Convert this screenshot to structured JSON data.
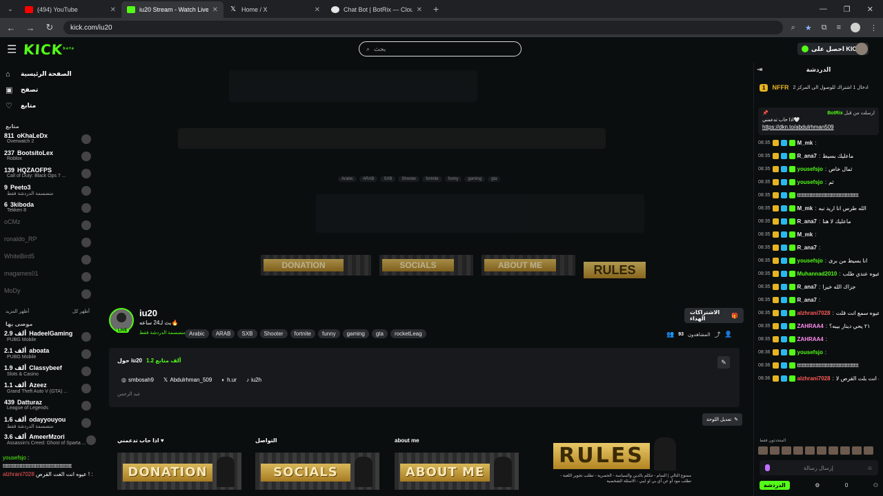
{
  "browser": {
    "tabs": [
      {
        "title": "(494) YouTube",
        "icon": "youtube-icon",
        "active": false
      },
      {
        "title": "iu20 Stream - Watch Live on Ki",
        "icon": "kick-icon",
        "active": true
      },
      {
        "title": "Home / X",
        "icon": "x-icon",
        "active": false
      },
      {
        "title": "Chat Bot | BotRix — Cloud Strea",
        "icon": "botrix-icon",
        "active": false
      }
    ],
    "url": "kick.com/iu20"
  },
  "header": {
    "logo": "KICK",
    "logo_sup": "beta",
    "search_placeholder": "بحث",
    "get_kicks": "احصل على KICKs"
  },
  "sidebar": {
    "nav": [
      {
        "label": "الصفحة الرئيسية",
        "icon": "home-icon"
      },
      {
        "label": "تصفح",
        "icon": "browse-icon"
      },
      {
        "label": "متابع",
        "icon": "heart-icon"
      }
    ],
    "following_title": "متابع",
    "following": [
      {
        "name": "oKhaLeDx",
        "viewers": "811",
        "category": "Overwatch 2"
      },
      {
        "name": "BootsitoLex",
        "viewers": "237",
        "category": "Roblox"
      },
      {
        "name": "HQZAOFPS",
        "viewers": "139",
        "category": "Call of Duty: Black Ops 7 ..."
      },
      {
        "name": "Peeto3",
        "viewers": "9",
        "category": "منصسمة الدردشة فقط"
      },
      {
        "name": "3kiboda",
        "viewers": "6",
        "category": "Tekken 8"
      }
    ],
    "offline": [
      "oCMz",
      "ronaldo_RP",
      "WhiteBird5",
      "magames01",
      "MoDy"
    ],
    "show_more": "أظهر المزيد",
    "show_all": "أظهر كل",
    "recommended_title": "موصى بها",
    "recommended": [
      {
        "name": "HadeelGaming",
        "viewers": "2.9 ألف",
        "category": "PUBG Mobile"
      },
      {
        "name": "aboata",
        "viewers": "2.1 ألف",
        "category": "PUBG Mobile"
      },
      {
        "name": "Classybeef",
        "viewers": "1.9 ألف",
        "category": "Slots & Casino"
      },
      {
        "name": "Azeez",
        "viewers": "1.1 ألف",
        "category": "Grand Theft Auto V (GTA) ..."
      },
      {
        "name": "Datturaz",
        "viewers": "439",
        "category": "League of Legends"
      },
      {
        "name": "odayyouyou",
        "viewers": "1.6 ألف",
        "category": "منصسمة الدردشة فقط"
      },
      {
        "name": "AmeerMzori",
        "viewers": "3.6 ألف",
        "category": "Assassin's Creed: Ghost of Sparta ..."
      }
    ],
    "overlay": [
      {
        "user": "yousefsjo",
        "text": ":"
      },
      {
        "user": "",
        "text": "ttttttttttttttttttttttttttttttttttttttttttttt"
      },
      {
        "user": "alzhrani7028",
        "text": "عيوه انت الغت القرص ! :"
      }
    ]
  },
  "channel": {
    "name": "iu20",
    "live_badge": "LIVE",
    "subtitle": "بث لـ24 ساعه🔥",
    "category": "منصسمة الدردشة فقط",
    "tags": [
      "Arabic",
      "ARAB",
      "SXB",
      "Shooter",
      "fortnite",
      "funny",
      "gaming",
      "gta",
      "rocketLeag"
    ],
    "sub_button": "الاشتراكات الهداء",
    "viewers_label": "المشاهدون",
    "viewers": "93",
    "about_title": "حول iu20",
    "followers": "1.2 ألف متابع",
    "socials": [
      {
        "icon": "instagram-icon",
        "label": "smbosah9"
      },
      {
        "icon": "x-icon",
        "label": "Abdulrhman_509"
      },
      {
        "icon": "discord-icon",
        "label": "h.ur"
      },
      {
        "icon": "tiktok-icon",
        "label": "iu2h"
      }
    ],
    "bio": "عبد الرحمن",
    "edit_panels": "تعديل اللوحة",
    "panels": [
      {
        "label": "اذا حاب تدعمني ♥",
        "banner": "DONATION"
      },
      {
        "label": "التواصل",
        "banner": "SOCIALS"
      },
      {
        "label": "about me",
        "banner": "ABOUT ME"
      }
    ],
    "rules_banner": "RULES",
    "rules_text": "ممنوع التالي | السام - تتكلم بالدين والسياسة - الحصرية - تطلب تجوير اللعبة - تطلب مود أو عن أي بي او ايبي - الاسئلة الشخصية"
  },
  "chat": {
    "title": "الدردشة",
    "goal_badge": "1",
    "goal_title": "NFFR",
    "goal_text": "ادخال 1 اشتراك للوصول الى المركز 2",
    "pinned_by": "BotRix",
    "pinned_label": "ارسلت من قبل",
    "pinned_text": "اذا حاب تدعمني🤍",
    "pinned_link": "https://dkn.to/abdulrhman509",
    "messages": [
      {
        "time": "08:35",
        "user": "M_mk",
        "color": "#e9e9e9",
        "text": ""
      },
      {
        "time": "08:35",
        "user": "R_ana7",
        "color": "#e9e9e9",
        "text": "ماعليك بسيط"
      },
      {
        "time": "08:35",
        "user": "yousefsjo",
        "color": "#53fc18",
        "text": "ثمال خاص"
      },
      {
        "time": "08:35",
        "user": "yousefsjo",
        "color": "#53fc18",
        "text": "ثم"
      },
      {
        "time": "08:35",
        "user": "",
        "color": "#ffffff",
        "text": "tttttttttttttttttttttttttttttttttttttttt"
      },
      {
        "time": "08:35",
        "user": "M_mk",
        "color": "#e9e9e9",
        "text": "الله طرس انا اريد نبه"
      },
      {
        "time": "08:35",
        "user": "R_ana7",
        "color": "#e9e9e9",
        "text": "ماعليك لا هنا"
      },
      {
        "time": "08:35",
        "user": "M_mk",
        "color": "#e9e9e9",
        "text": ""
      },
      {
        "time": "08:35",
        "user": "R_ana7",
        "color": "#e9e9e9",
        "text": ""
      },
      {
        "time": "08:35",
        "user": "yousefsjo",
        "color": "#53fc18",
        "text": "انا بسيط من برى"
      },
      {
        "time": "08:35",
        "user": "Muhannad2010",
        "color": "#53fc18",
        "text": "عيوه عندي طلب"
      },
      {
        "time": "08:35",
        "user": "R_ana7",
        "color": "#e9e9e9",
        "text": "جزاك الله خيرا"
      },
      {
        "time": "08:35",
        "user": "R_ana7",
        "color": "#e9e9e9",
        "text": ""
      },
      {
        "time": "08:35",
        "user": "alzhrani7028",
        "color": "#ff5a5a",
        "text": "عيوه سمع انت قلت"
      },
      {
        "time": "08:35",
        "user": "ZAHRAA4",
        "color": "#ff8cf0",
        "text": "٢١ يحي دينار بيبه؟"
      },
      {
        "time": "08:35",
        "user": "ZAHRAA4",
        "color": "#ff8cf0",
        "text": ""
      },
      {
        "time": "08:36",
        "user": "yousefsjo",
        "color": "#53fc18",
        "text": ""
      },
      {
        "time": "08:36",
        "user": "",
        "color": "#ffffff",
        "text": "tttttttttttttttttttttttttttttttttttttttt"
      },
      {
        "time": "08:36",
        "user": "alzhrani7028",
        "color": "#ff5a5a",
        "text": "عيوه انت بلت القرص لا"
      }
    ],
    "chatters_label": "المتحدثون فقط",
    "input_placeholder": "إرسال رسالة",
    "count": "0",
    "send": "الدردشة"
  }
}
